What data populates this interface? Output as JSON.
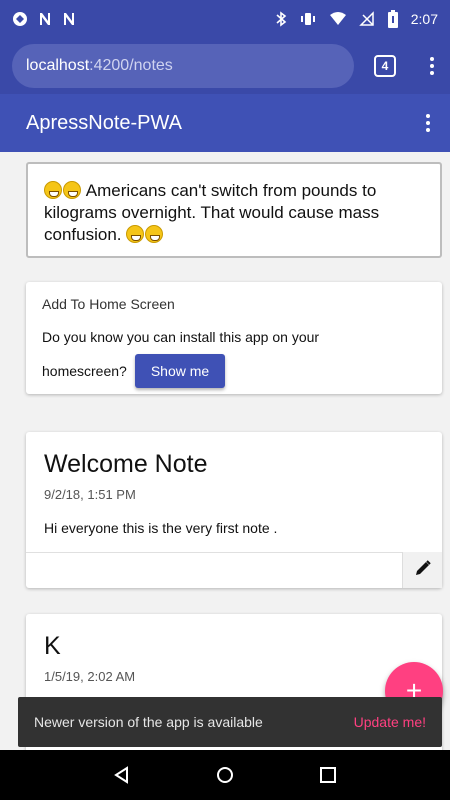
{
  "status_bar": {
    "time": "2:07",
    "left_icons": [
      "shield-icon",
      "n-notification-icon",
      "n-notification-icon"
    ],
    "right_icons": [
      "bluetooth-icon",
      "vibrate-icon",
      "wifi-icon",
      "no-signal-icon",
      "battery-icon"
    ]
  },
  "browser": {
    "url_host": "localhost",
    "url_path": ":4200/notes",
    "tab_count": "4"
  },
  "toolbar": {
    "title": "ApressNote-PWA"
  },
  "quote": {
    "text": "Americans can't switch from pounds to kilograms overnight. That would cause mass confusion."
  },
  "add_to_home": {
    "title": "Add To Home Screen",
    "line1": "Do you know you can install this app on your",
    "line2": "homescreen?",
    "button_label": "Show me"
  },
  "notes": [
    {
      "title": "Welcome Note",
      "date": "9/2/18, 1:51 PM",
      "body": "Hi everyone this is the very first note ."
    },
    {
      "title": "K",
      "date": "1/5/19, 2:02 AM",
      "body": ""
    }
  ],
  "fab": {
    "label": "+"
  },
  "snackbar": {
    "message": "Newer version of the app is available",
    "action": "Update me!"
  },
  "colors": {
    "primary": "#3f51b5",
    "accent": "#ff4081",
    "snackbar": "#323232"
  }
}
